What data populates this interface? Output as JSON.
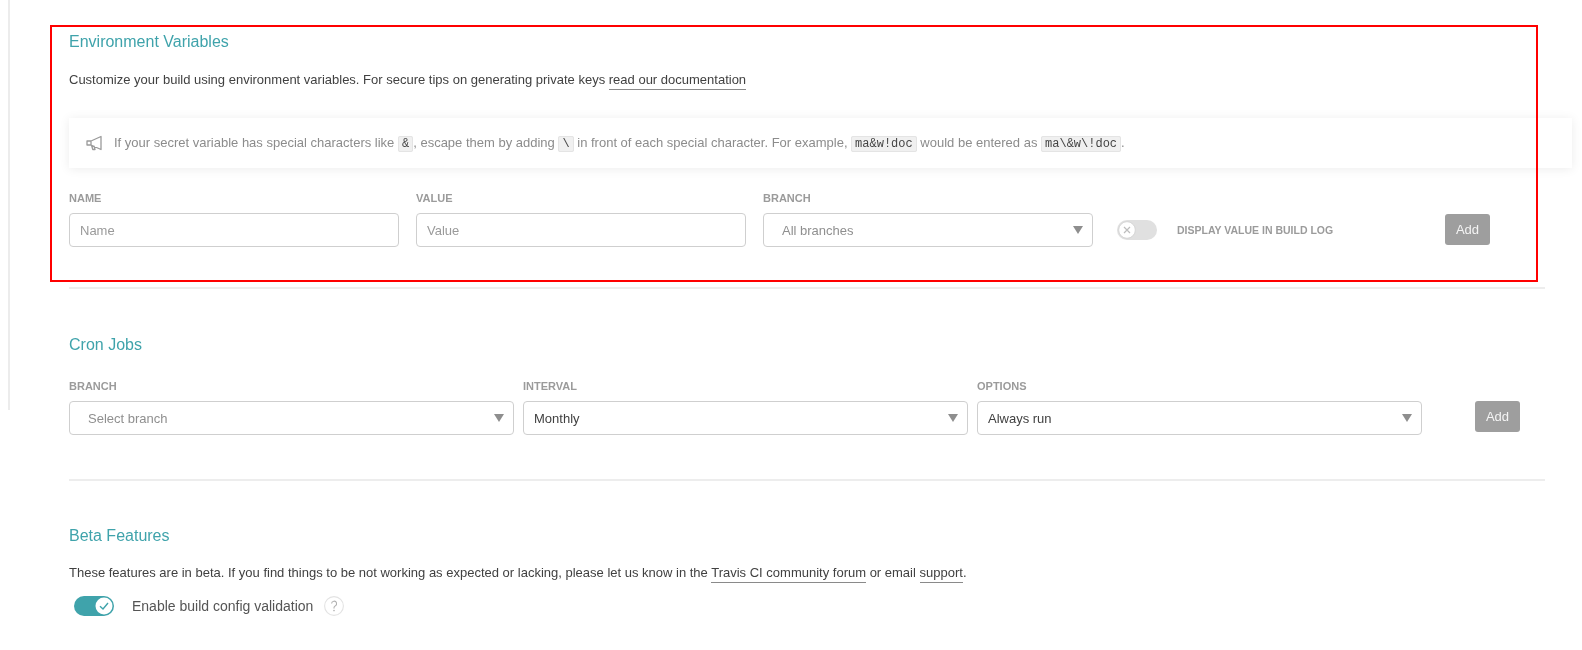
{
  "environment_variables": {
    "title": "Environment Variables",
    "highlighted": true,
    "description": [
      {
        "kind": "text",
        "text": "Customize your build using environment variables. For secure tips on generating private keys "
      },
      {
        "kind": "link",
        "text": "read our documentation"
      }
    ],
    "note": [
      {
        "kind": "text",
        "text": "If your secret variable has special characters like "
      },
      {
        "kind": "code",
        "text": "&"
      },
      {
        "kind": "text",
        "text": ", escape them by adding "
      },
      {
        "kind": "code",
        "text": "\\"
      },
      {
        "kind": "text",
        "text": " in front of each special character. For example, "
      },
      {
        "kind": "code",
        "text": "ma&w!doc"
      },
      {
        "kind": "text",
        "text": " would be entered as "
      },
      {
        "kind": "code",
        "text": "ma\\&w\\!doc"
      },
      {
        "kind": "text",
        "text": "."
      }
    ],
    "fields": [
      {
        "kind": "input",
        "label": "NAME",
        "placeholder": "Name"
      },
      {
        "kind": "input",
        "label": "VALUE",
        "placeholder": "Value"
      },
      {
        "kind": "select",
        "label": "BRANCH",
        "placeholder": "All branches"
      }
    ],
    "display_toggle": {
      "label": "DISPLAY VALUE IN BUILD LOG",
      "on": false
    },
    "add_button": {
      "label": "Add",
      "disabled": true
    }
  },
  "cron_jobs": {
    "title": "Cron Jobs",
    "fields": [
      {
        "kind": "select",
        "label": "BRANCH",
        "placeholder": "Select branch"
      },
      {
        "kind": "select",
        "label": "INTERVAL",
        "value": "Monthly"
      },
      {
        "kind": "select",
        "label": "OPTIONS",
        "value": "Always run"
      }
    ],
    "add_button": {
      "label": "Add",
      "disabled": true
    }
  },
  "beta_features": {
    "title": "Beta Features",
    "description": [
      {
        "kind": "text",
        "text": "These features are in beta. If you find things to be not working as expected or lacking, please let us know in the "
      },
      {
        "kind": "link",
        "text": "Travis CI community forum"
      },
      {
        "kind": "text",
        "text": " or email "
      },
      {
        "kind": "link",
        "text": "support"
      },
      {
        "kind": "text",
        "text": "."
      }
    ],
    "options": [
      {
        "label": "Enable build config validation",
        "on": true
      }
    ]
  }
}
